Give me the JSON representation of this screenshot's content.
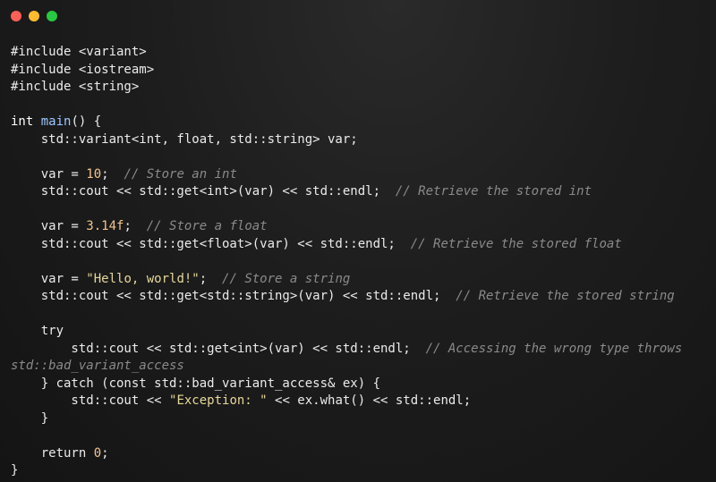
{
  "window": {
    "buttons": {
      "close_color": "#ff5f57",
      "minimize_color": "#febc2e",
      "maximize_color": "#28c840"
    }
  },
  "code": {
    "language": "cpp",
    "lines": [
      [
        {
          "t": "#include <variant>",
          "c": ""
        }
      ],
      [
        {
          "t": "#include <iostream>",
          "c": ""
        }
      ],
      [
        {
          "t": "#include <string>",
          "c": ""
        }
      ],
      [],
      [
        {
          "t": "int ",
          "c": "k"
        },
        {
          "t": "main",
          "c": "fn"
        },
        {
          "t": "() {",
          "c": ""
        }
      ],
      [
        {
          "t": "    std::variant<int, float, std::string> var;",
          "c": ""
        }
      ],
      [],
      [
        {
          "t": "    var = ",
          "c": ""
        },
        {
          "t": "10",
          "c": "num"
        },
        {
          "t": ";  ",
          "c": ""
        },
        {
          "t": "// Store an int",
          "c": "cm"
        }
      ],
      [
        {
          "t": "    std::cout << std::get<int>(var) << std::endl;  ",
          "c": ""
        },
        {
          "t": "// Retrieve the stored int",
          "c": "cm"
        }
      ],
      [],
      [
        {
          "t": "    var = ",
          "c": ""
        },
        {
          "t": "3.14f",
          "c": "num"
        },
        {
          "t": ";  ",
          "c": ""
        },
        {
          "t": "// Store a float",
          "c": "cm"
        }
      ],
      [
        {
          "t": "    std::cout << std::get<float>(var) << std::endl;  ",
          "c": ""
        },
        {
          "t": "// Retrieve the stored float",
          "c": "cm"
        }
      ],
      [],
      [
        {
          "t": "    var = ",
          "c": ""
        },
        {
          "t": "\"Hello, world!\"",
          "c": "str"
        },
        {
          "t": ";  ",
          "c": ""
        },
        {
          "t": "// Store a string",
          "c": "cm"
        }
      ],
      [
        {
          "t": "    std::cout << std::get<std::string>(var) << std::endl;  ",
          "c": ""
        },
        {
          "t": "// Retrieve the stored string",
          "c": "cm"
        }
      ],
      [],
      [
        {
          "t": "    try",
          "c": ""
        }
      ],
      [
        {
          "t": "        std::cout << std::get<int>(var) << std::endl;  ",
          "c": ""
        },
        {
          "t": "// Accessing the wrong type throws",
          "c": "cm"
        }
      ],
      [
        {
          "t": "std::bad_variant_access",
          "c": "cm"
        }
      ],
      [
        {
          "t": "    } catch (const std::bad_variant_access& ex) {",
          "c": ""
        }
      ],
      [
        {
          "t": "        std::cout << ",
          "c": ""
        },
        {
          "t": "\"Exception: \"",
          "c": "str"
        },
        {
          "t": " << ex.what() << std::endl;",
          "c": ""
        }
      ],
      [
        {
          "t": "    }",
          "c": ""
        }
      ],
      [],
      [
        {
          "t": "    return ",
          "c": ""
        },
        {
          "t": "0",
          "c": "num"
        },
        {
          "t": ";",
          "c": ""
        }
      ],
      [
        {
          "t": "}",
          "c": ""
        }
      ]
    ]
  }
}
